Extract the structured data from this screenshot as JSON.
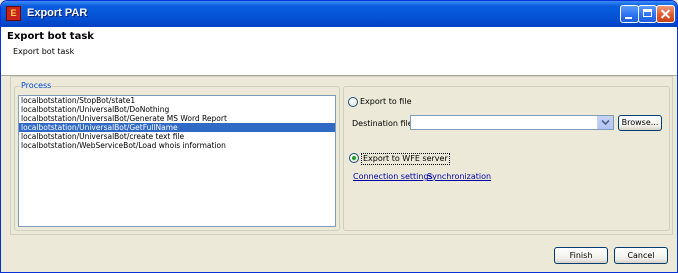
{
  "window": {
    "title": "Export PAR",
    "icon_text": "PAR"
  },
  "header": {
    "title": "Export bot task",
    "description": "Export bot task"
  },
  "process": {
    "legend": "Process",
    "items": [
      "localbotstation/StopBot/state1",
      "localbotstation/UniversalBot/DoNothing",
      "localbotstation/UniversalBot/Generate MS Word Report",
      "localbotstation/UniversalBot/GetFullName",
      "localbotstation/UniversalBot/create text file",
      "localbotstation/WebServiceBot/Load whois information"
    ],
    "selected_index": 3
  },
  "export": {
    "to_file_label": "Export to file",
    "destination_label": "Destination file:",
    "destination_value": "",
    "browse_label": "Browse...",
    "to_wfe_label": "Export to WFE server",
    "selected": "wfe",
    "connection_settings_link": "Connection settings",
    "synchronization_link": "Synchronization"
  },
  "buttons": {
    "finish": "Finish",
    "cancel": "Cancel"
  },
  "colors": {
    "selection": "#316ac5",
    "link": "#0000aa",
    "legend": "#0046d5"
  }
}
